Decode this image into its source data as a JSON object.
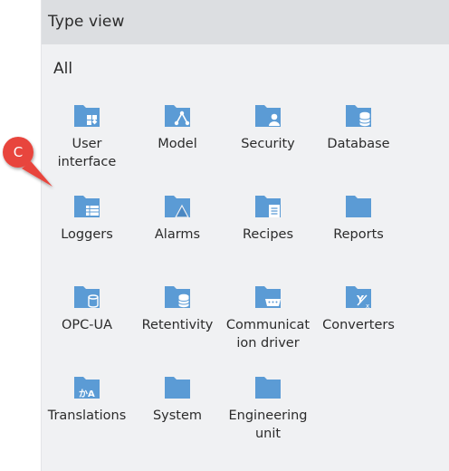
{
  "panel": {
    "title": "Type view"
  },
  "section": {
    "title": "All"
  },
  "items": [
    {
      "label": "User\ninterface",
      "icon": "user-interface-icon"
    },
    {
      "label": "Model",
      "icon": "model-icon"
    },
    {
      "label": "Security",
      "icon": "security-icon"
    },
    {
      "label": "Database",
      "icon": "database-icon"
    },
    {
      "label": "Loggers",
      "icon": "loggers-icon"
    },
    {
      "label": "Alarms",
      "icon": "alarms-icon"
    },
    {
      "label": "Recipes",
      "icon": "recipes-icon"
    },
    {
      "label": "Reports",
      "icon": "reports-icon"
    },
    {
      "label": "OPC-UA",
      "icon": "opc-ua-icon"
    },
    {
      "label": "Retentivity",
      "icon": "retentivity-icon"
    },
    {
      "label": "Communicat\nion driver",
      "icon": "communication-driver-icon"
    },
    {
      "label": "Converters",
      "icon": "converters-icon"
    },
    {
      "label": "Translations",
      "icon": "translations-icon"
    },
    {
      "label": "System",
      "icon": "system-icon"
    },
    {
      "label": "Engineering\nunit",
      "icon": "engineering-unit-icon"
    }
  ],
  "callout": {
    "letter": "C",
    "color": "#e8453c"
  },
  "colors": {
    "folder": "#5b9bd5",
    "folder_dark": "#4a87c2",
    "panel_bg": "#f0f1f3",
    "header_bg": "#dcdee1"
  }
}
